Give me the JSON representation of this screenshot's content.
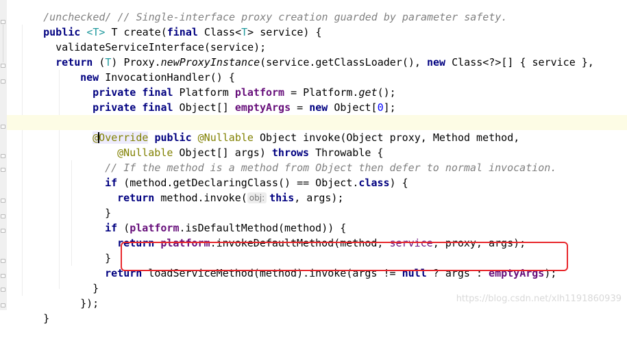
{
  "code": {
    "line0": "/unchecked/ // Single-interface proxy creation guarded by parameter safety.",
    "line1": {
      "public": "public",
      "generic": "<T>",
      "rest1": " T create(",
      "final": "final",
      "rest2": " Class<",
      "generic2": "T",
      "rest3": "> service) {"
    },
    "line2": "validateServiceInterface(service);",
    "line3": {
      "return": "return",
      "cast1": " (",
      "cast_t": "T",
      "cast2": ") Proxy.",
      "method": "newProxyInstance",
      "rest1": "(service.getClassLoader(), ",
      "new": "new",
      "rest2": " Class<?>[] { service },"
    },
    "line4": {
      "new": "new",
      "rest": " InvocationHandler() {"
    },
    "line5": {
      "private": "private",
      "final": "final",
      "type": " Platform ",
      "field": "platform",
      "eq": " = Platform.",
      "method": "get",
      "end": "();"
    },
    "line6": {
      "private": "private",
      "final": "final",
      "type": " Object[] ",
      "field": "emptyArgs",
      "eq": " = ",
      "new": "new",
      "rest": " Object[",
      "num": "0",
      "end": "];"
    },
    "line8": {
      "at": "@",
      "o": "O",
      "verride": "verride",
      "public": "public",
      "nullable": "@Nullable",
      "rest": " Object invoke(Object proxy, Method method,"
    },
    "line9": {
      "nullable": "@Nullable",
      "rest": " Object[] args) ",
      "throws": "throws",
      "rest2": " Throwable {"
    },
    "line10": "// If the method is a method from Object then defer to normal invocation.",
    "line11": {
      "if": "if",
      "rest": " (method.getDeclaringClass() == Object.",
      "class": "class",
      "end": ") {"
    },
    "line12": {
      "return": "return",
      "rest": " method.invoke(",
      "hint": "obj:",
      "this": "this",
      "end": ", args);"
    },
    "line13": "}",
    "line14": {
      "if": "if",
      "open": " (",
      "field": "platform",
      "rest": ".isDefaultMethod(method)) {"
    },
    "line15": {
      "return": "return",
      "field": "platform",
      "rest1": ".invokeDefaultMethod(method, ",
      "service": "service",
      "rest2": ", proxy, args);"
    },
    "line16": "}",
    "line17": {
      "return": "return",
      "rest1": "loadServiceMethod(method).invoke(args != ",
      "null": "null",
      "rest2": " ? args : ",
      "field": "emptyArgs",
      "end": ");"
    },
    "line18": "}",
    "line19": "});",
    "line20": "}"
  },
  "watermark": "https://blog.csdn.net/xlh1191860939",
  "colors": {
    "keyword": "#000080",
    "field": "#660e7a",
    "annotation": "#808000",
    "comment": "#808080",
    "number": "#0000ff",
    "highlight_box": "#e8262b",
    "caret_line": "#fdfce5"
  }
}
